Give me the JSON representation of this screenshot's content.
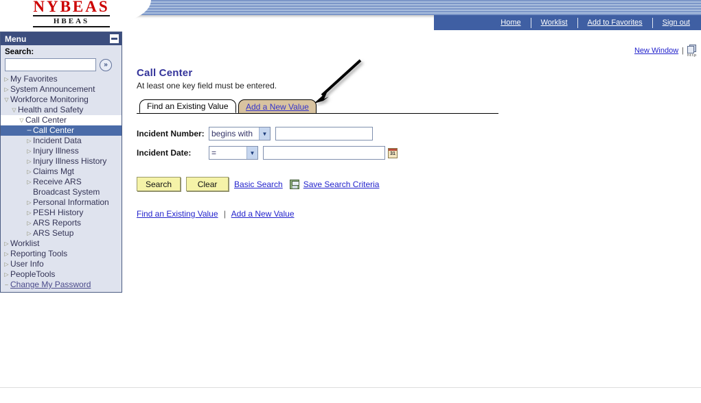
{
  "header": {
    "logo_main": "NYBEAS",
    "logo_sub": "HBEAS",
    "nav_links": [
      "Home",
      "Worklist",
      "Add to Favorites",
      "Sign out"
    ]
  },
  "toolbar": {
    "new_window": "New Window",
    "divider": "|",
    "http_icon_label": "http"
  },
  "sidebar": {
    "title": "Menu",
    "search_label": "Search:",
    "search_value": "",
    "search_placeholder": "",
    "go_label": "»",
    "items": [
      {
        "label": "My Favorites",
        "level": 0,
        "marker": "collapsed",
        "state": "normal"
      },
      {
        "label": "System Announcement",
        "level": 0,
        "marker": "collapsed",
        "state": "normal"
      },
      {
        "label": "Workforce Monitoring",
        "level": 0,
        "marker": "expanded",
        "state": "normal"
      },
      {
        "label": "Health and Safety",
        "level": 1,
        "marker": "expanded",
        "state": "normal"
      },
      {
        "label": "Call Center",
        "level": 2,
        "marker": "expanded",
        "state": "white"
      },
      {
        "label": "Call Center",
        "level": 3,
        "marker": "dash",
        "state": "selected"
      },
      {
        "label": "Incident Data",
        "level": 3,
        "marker": "collapsed",
        "state": "normal"
      },
      {
        "label": "Injury Illness",
        "level": 3,
        "marker": "collapsed",
        "state": "normal"
      },
      {
        "label": "Injury Illness History",
        "level": 3,
        "marker": "collapsed",
        "state": "normal"
      },
      {
        "label": "Claims Mgt",
        "level": 3,
        "marker": "collapsed",
        "state": "normal"
      },
      {
        "label": "Receive ARS Broadcast System",
        "level": 3,
        "marker": "collapsed",
        "state": "normal"
      },
      {
        "label": "Personal Information",
        "level": 3,
        "marker": "collapsed",
        "state": "normal"
      },
      {
        "label": "PESH History",
        "level": 3,
        "marker": "collapsed",
        "state": "normal"
      },
      {
        "label": "ARS Reports",
        "level": 3,
        "marker": "collapsed",
        "state": "normal"
      },
      {
        "label": "ARS Setup",
        "level": 3,
        "marker": "collapsed",
        "state": "normal"
      },
      {
        "label": "Worklist",
        "level": 0,
        "marker": "collapsed",
        "state": "normal"
      },
      {
        "label": "Reporting Tools",
        "level": 0,
        "marker": "collapsed",
        "state": "normal"
      },
      {
        "label": "User Info",
        "level": 0,
        "marker": "collapsed",
        "state": "normal"
      },
      {
        "label": "PeopleTools",
        "level": 0,
        "marker": "collapsed",
        "state": "normal"
      },
      {
        "label": "Change My Password",
        "level": 0,
        "marker": "dash",
        "state": "link"
      }
    ]
  },
  "main": {
    "title": "Call Center",
    "subtitle": "At least one key field must be entered.",
    "tabs": [
      {
        "label": "Find an Existing Value",
        "active": true
      },
      {
        "label": "Add a New Value",
        "active": false
      }
    ],
    "fields": [
      {
        "label": "Incident Number:",
        "operator": "begins with",
        "value": "",
        "has_calendar": false
      },
      {
        "label": "Incident Date:",
        "operator": "=",
        "value": "",
        "has_calendar": true,
        "calendar_label": "31"
      }
    ],
    "buttons": {
      "search": "Search",
      "clear": "Clear"
    },
    "links": {
      "basic_search": "Basic Search",
      "save_search_criteria": "Save Search Criteria"
    },
    "footer_links": {
      "find_existing": "Find an Existing Value",
      "separator": "|",
      "add_new": "Add a New Value"
    }
  },
  "colors": {
    "banner_blue": "#7b96c8",
    "navbar_blue": "#3f5fa3",
    "menu_header": "#3c4e7e",
    "menu_selected": "#4a6ba8",
    "sidebar_bg": "#dfe3ee",
    "logo_red": "#cc0000",
    "title_blue": "#33339a",
    "link_blue": "#2222cc",
    "button_yellow": "#f5f3a8",
    "tab_inactive": "#d8c3a0"
  }
}
